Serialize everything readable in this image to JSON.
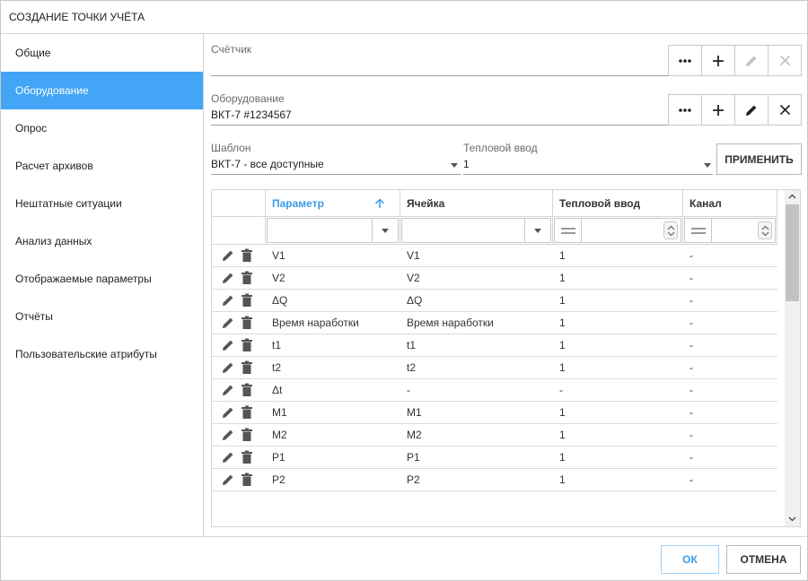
{
  "dialog": {
    "title": "СОЗДАНИЕ ТОЧКИ УЧЁТА"
  },
  "sidebar": {
    "items": [
      {
        "label": "Общие"
      },
      {
        "label": "Оборудование"
      },
      {
        "label": "Опрос"
      },
      {
        "label": "Расчет архивов"
      },
      {
        "label": "Нештатные ситуации"
      },
      {
        "label": "Анализ данных"
      },
      {
        "label": "Отображаемые параметры"
      },
      {
        "label": "Отчёты"
      },
      {
        "label": "Пользовательские атрибуты"
      }
    ],
    "active_index": 1
  },
  "meter": {
    "label": "Счётчик",
    "value": ""
  },
  "equipment": {
    "label": "Оборудование",
    "value": "ВКТ-7 #1234567"
  },
  "template": {
    "label": "Шаблон",
    "value": "ВКТ-7 - все доступные"
  },
  "heat_input": {
    "label": "Тепловой ввод",
    "value": "1"
  },
  "apply_label": "ПРИМЕНИТЬ",
  "icons": {
    "more": "more-horiz-icon",
    "add": "plus-icon",
    "edit": "pencil-icon",
    "remove": "close-icon",
    "delete": "trash-icon",
    "sort": "arrow-up-icon"
  },
  "table": {
    "columns": [
      "Параметр",
      "Ячейка",
      "Тепловой ввод",
      "Канал"
    ],
    "sorted_column": 0,
    "rows": [
      [
        "V1",
        "V1",
        "1",
        "-"
      ],
      [
        "V2",
        "V2",
        "1",
        "-"
      ],
      [
        "ΔQ",
        "ΔQ",
        "1",
        "-"
      ],
      [
        "Время наработки",
        "Время наработки",
        "1",
        "-"
      ],
      [
        "t1",
        "t1",
        "1",
        "-"
      ],
      [
        "t2",
        "t2",
        "1",
        "-"
      ],
      [
        "Δt",
        "-",
        "-",
        "-"
      ],
      [
        "M1",
        "M1",
        "1",
        "-"
      ],
      [
        "M2",
        "M2",
        "1",
        "-"
      ],
      [
        "P1",
        "P1",
        "1",
        "-"
      ],
      [
        "P2",
        "P2",
        "1",
        "-"
      ]
    ]
  },
  "footer": {
    "ok_label": "ОК",
    "cancel_label": "ОТМЕНА"
  },
  "colors": {
    "accent": "#42a5f5",
    "sort_header": "#3a9be8",
    "ok_border": "#9fd0f6"
  }
}
